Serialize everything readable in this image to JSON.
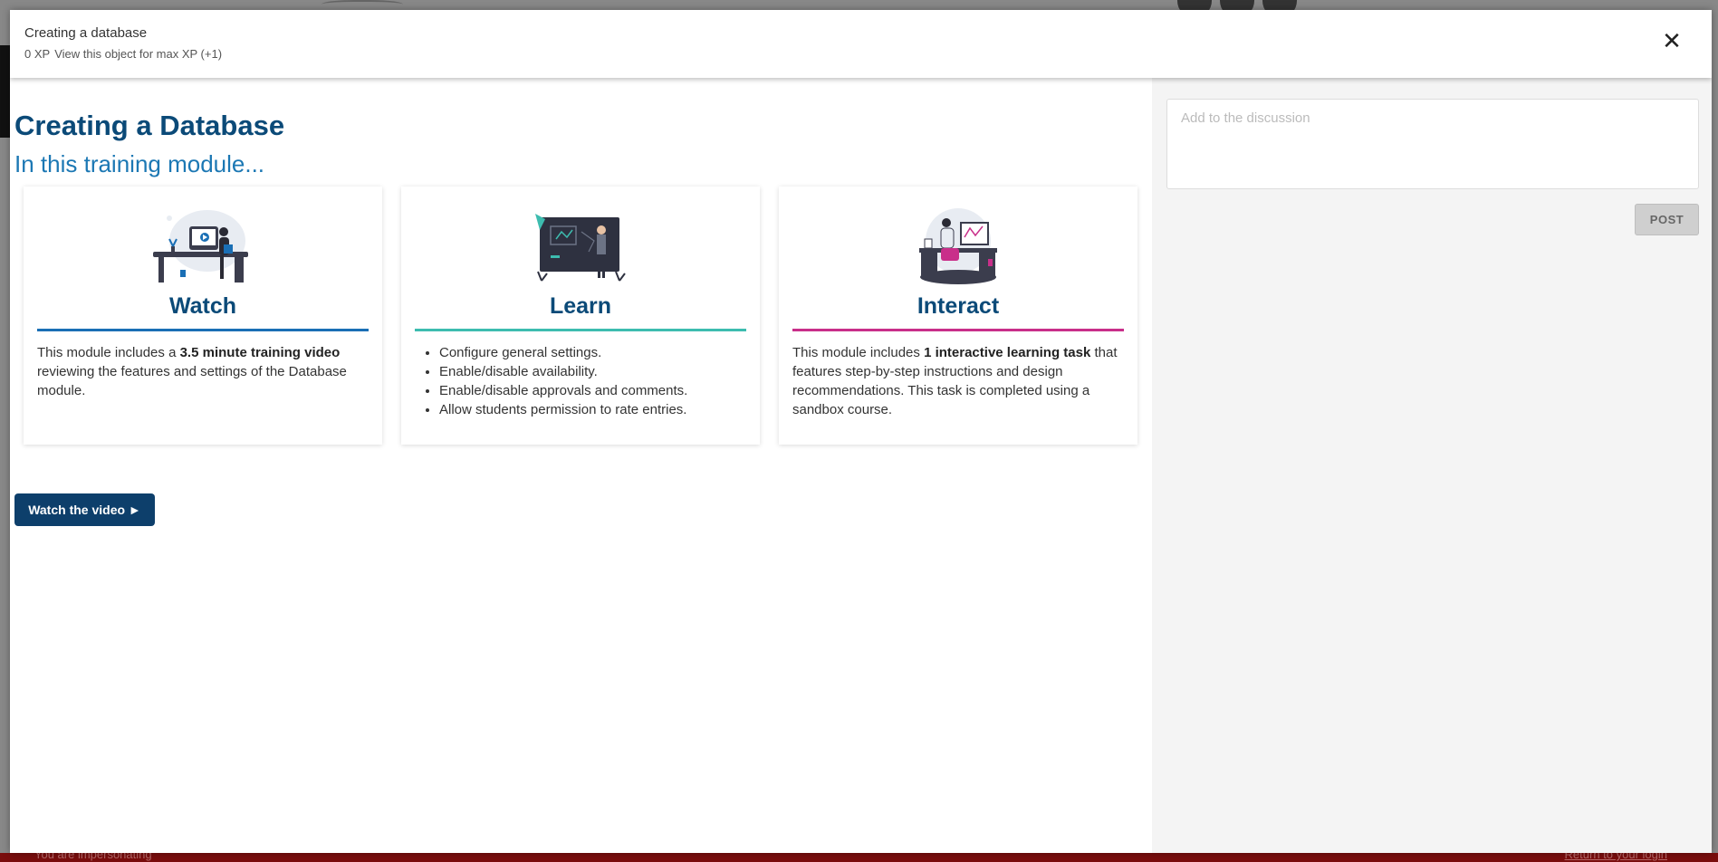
{
  "background": {
    "footer_impersonating": "You are impersonating",
    "footer_return": "Return to your login"
  },
  "modal": {
    "title": "Creating a database",
    "xp_value": "0 XP",
    "xp_hint": "View this object for max XP (+1)",
    "close_icon": "close-icon"
  },
  "main": {
    "heading": "Creating a Database",
    "subheading": "In this training module...",
    "cards": [
      {
        "title": "Watch",
        "accent": "#1a6fb5",
        "text_before": "This module includes a ",
        "text_bold": "3.5 minute training video",
        "text_after": " reviewing the features and settings of the Database module."
      },
      {
        "title": "Learn",
        "accent": "#3dbcaf",
        "items": [
          "Configure general settings.",
          "Enable/disable availability.",
          "Enable/disable approvals and comments.",
          "Allow students permission to rate entries."
        ]
      },
      {
        "title": "Interact",
        "accent": "#c92f8a",
        "text_before": "This module includes ",
        "text_bold": "1 interactive learning task",
        "text_after": " that features step-by-step instructions and design recommendations. This task is completed using a sandbox course."
      }
    ],
    "watch_button": "Watch the video ►"
  },
  "sidebar": {
    "discussion_placeholder": "Add to the discussion",
    "post_button": "POST"
  }
}
